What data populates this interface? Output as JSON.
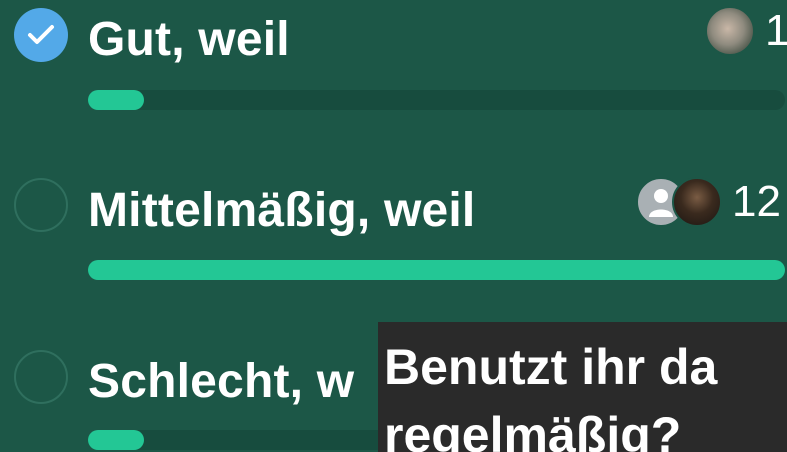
{
  "poll": {
    "options": [
      {
        "label": "Gut, weil",
        "selected": true,
        "vote_count": "1",
        "fill": 0.08
      },
      {
        "label": "Mittelmäßig, weil",
        "selected": false,
        "vote_count": "12",
        "fill": 1.0
      },
      {
        "label": "Schlecht, w",
        "selected": false,
        "vote_count": "",
        "fill": 0.08
      }
    ]
  },
  "overlay": {
    "line1": "Benutzt ihr da",
    "line2": "regelmäßig?"
  },
  "colors": {
    "background": "#1c5747",
    "bar_fill": "#23c795",
    "bar_track": "#174c3e",
    "checked": "#53a9e8",
    "overlay": "#2a2a2a"
  },
  "icons": [
    "checkmark-icon",
    "default-avatar-icon"
  ]
}
